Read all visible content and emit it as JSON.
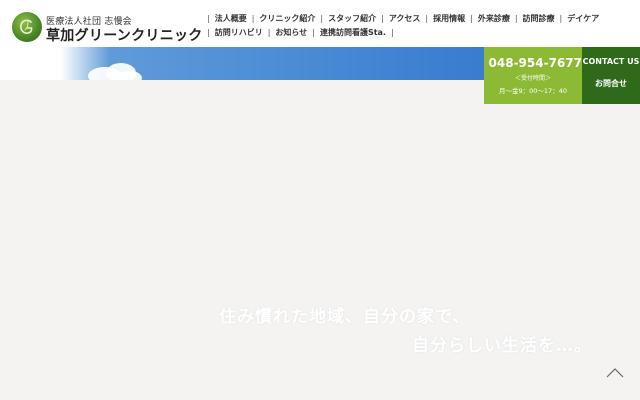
{
  "header": {
    "org_sub": "医療法人社団 志慢会",
    "org_name": "草加グリーンクリニック",
    "nav_row1": [
      "法人概要",
      "クリニック紹介",
      "スタッフ紹介",
      "アクセス",
      "採用情報",
      "外来診療",
      "訪問診療",
      "デイケア"
    ],
    "nav_row2": [
      "訪問リハビリ",
      "お知らせ",
      "連携訪問看護Sta."
    ]
  },
  "phone": {
    "number": "048-954-7677",
    "hours_label": "＜受付時間＞",
    "hours_value": "月～金9：00～17：40",
    "icon": "phone-icon"
  },
  "contact": {
    "label_en": "CONTACT US",
    "label_jp": "お問合せ"
  },
  "hero": {
    "line1": "住み慣れた地域、自分の家で、",
    "line2": "自分らしい生活を…。"
  },
  "colors": {
    "phone_bg": "#8dba35",
    "contact_bg": "#2f6a1a",
    "sky": "#3c7fd0",
    "page_bg": "#f4f3f2"
  },
  "scroll_top_icon": "chevron-up-icon"
}
